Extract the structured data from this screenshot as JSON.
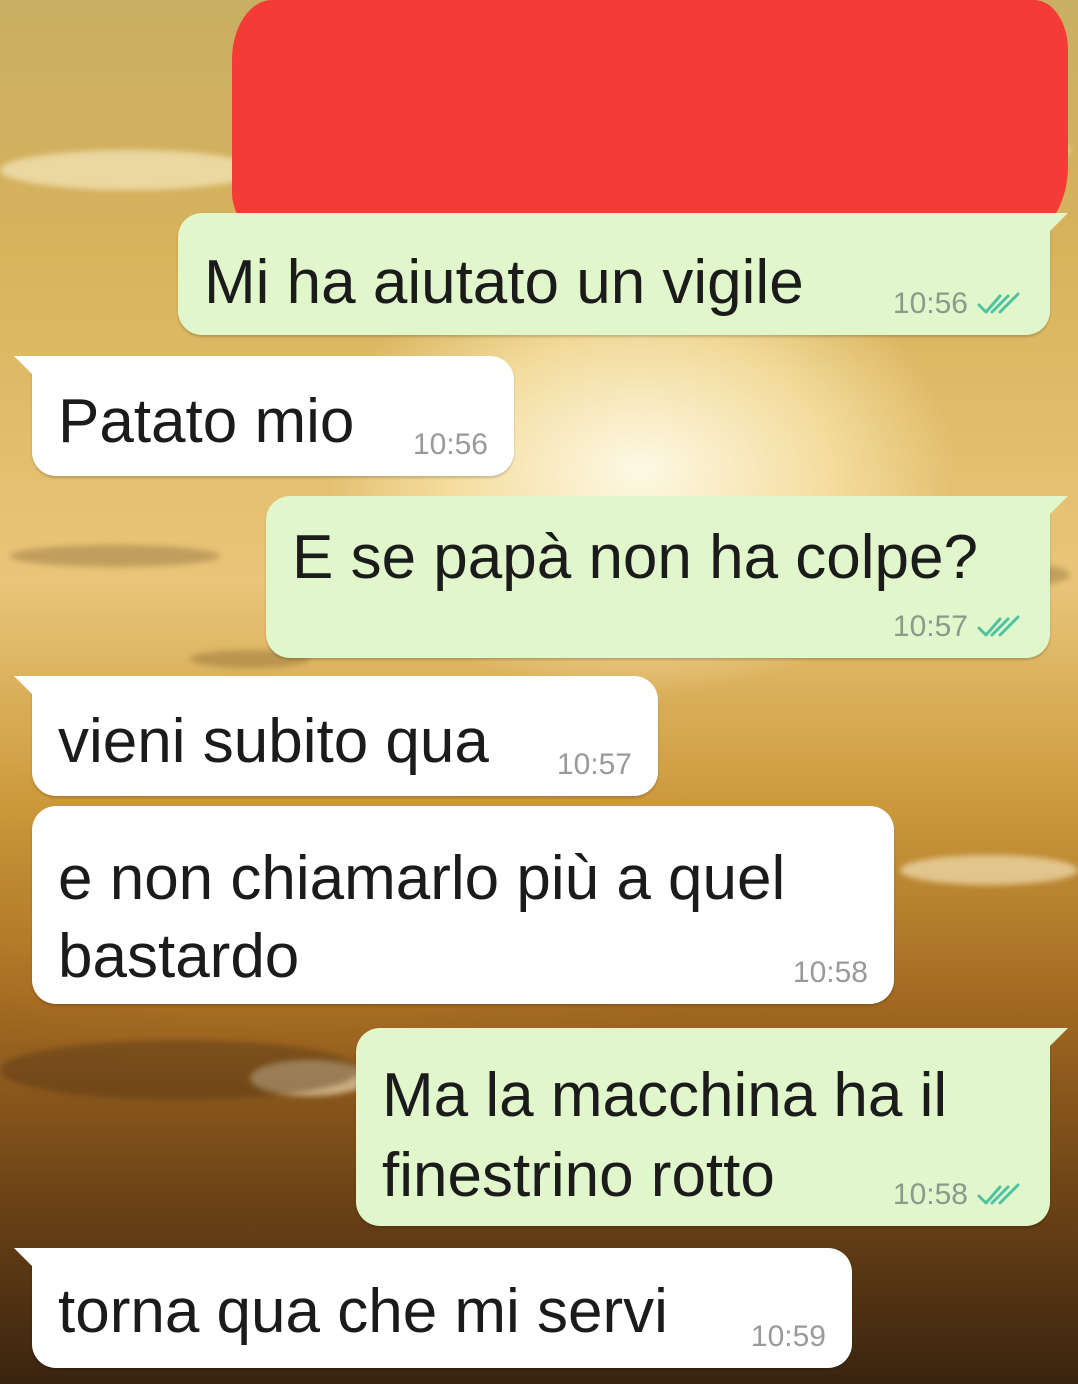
{
  "chat": {
    "messages": [
      {
        "direction": "out",
        "text": "Mi ha aiutato un vigile",
        "time": "10:56",
        "read": true
      },
      {
        "direction": "in",
        "text": "Patato mio",
        "time": "10:56"
      },
      {
        "direction": "out",
        "text": "E se papà non ha colpe?",
        "time": "10:57",
        "read": true
      },
      {
        "direction": "in",
        "text": "vieni subito qua",
        "time": "10:57"
      },
      {
        "direction": "in",
        "text": "e non chiamarlo più a quel\nbastardo",
        "time": "10:58"
      },
      {
        "direction": "out",
        "text": "Ma la macchina ha il\nfinestrino rotto",
        "time": "10:58",
        "read": true
      },
      {
        "direction": "in",
        "text": "torna qua che mi servi",
        "time": "10:59"
      }
    ]
  },
  "colors": {
    "outgoing_bubble": "#e1f7cb",
    "incoming_bubble": "#ffffff",
    "read_ticks": "#4fc3a1",
    "redaction": "#f53b36"
  },
  "icons": {
    "read_receipt": "double-check-icon"
  }
}
